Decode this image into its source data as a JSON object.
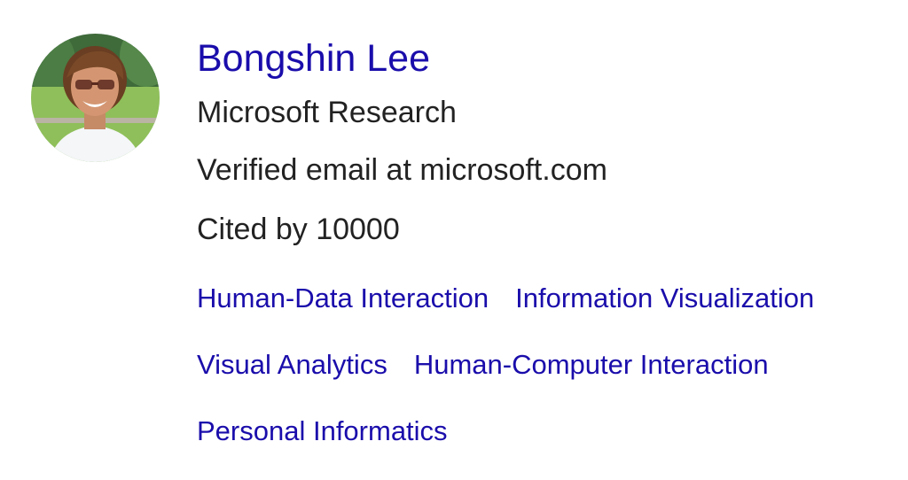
{
  "profile": {
    "name": "Bongshin Lee",
    "affiliation": "Microsoft Research",
    "email": "Verified email at microsoft.com",
    "cited_prefix": "Cited by",
    "cited_count": "10000"
  },
  "interests": [
    "Human-Data Interaction",
    "Information Visualization",
    "Visual Analytics",
    "Human-Computer Interaction",
    "Personal Informatics"
  ],
  "colors": {
    "link": "#1a0dab",
    "text": "#222222",
    "background": "#ffffff"
  },
  "icons": {
    "avatar": "profile-photo"
  }
}
